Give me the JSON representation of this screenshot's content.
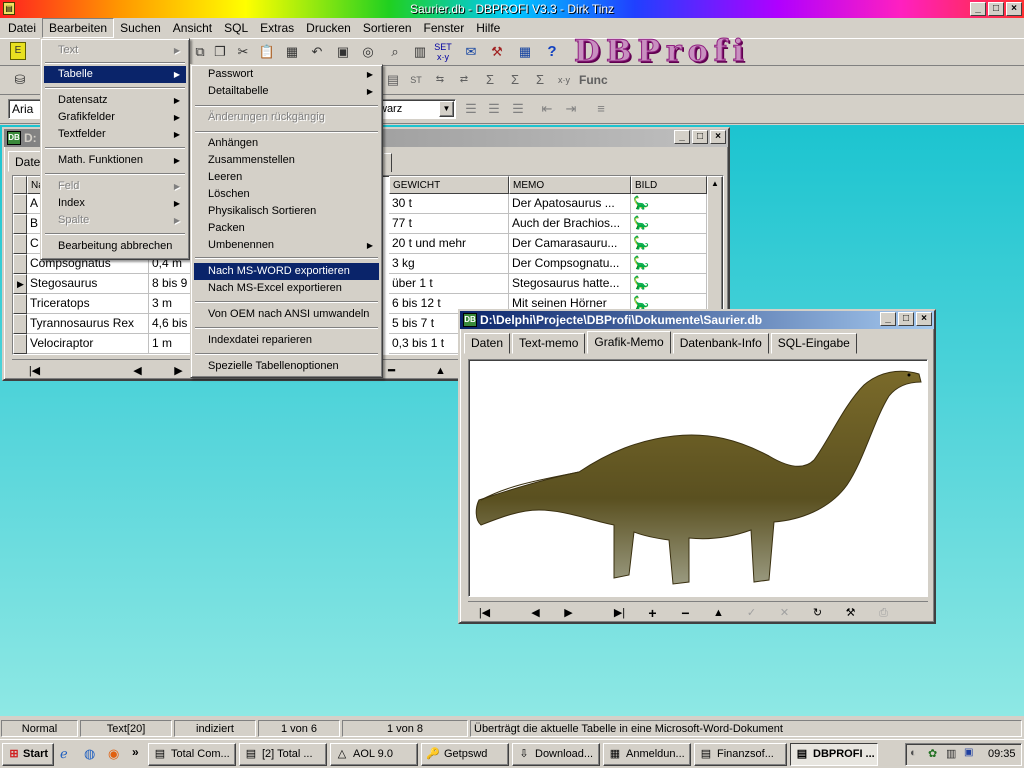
{
  "app": {
    "title": "Saurier.db - DBPROFI V3.3 - Dirk Tinz",
    "logo": "DBProfi",
    "window_buttons": [
      "_",
      "□",
      "×"
    ]
  },
  "menubar": [
    "Datei",
    "Bearbeiten",
    "Suchen",
    "Ansicht",
    "SQL",
    "Extras",
    "Drucken",
    "Sortieren",
    "Fenster",
    "Hilfe"
  ],
  "format_toolbar": {
    "font_value": "Aria",
    "color_value": "warz",
    "func_label": "Func"
  },
  "edit_menu": {
    "items": [
      {
        "label": "Text",
        "disabled": true,
        "submenu": true
      },
      {
        "label": "Tabelle",
        "disabled": false,
        "submenu": true,
        "highlighted": true
      },
      {
        "label": "Datensatz",
        "disabled": false,
        "submenu": true
      },
      {
        "label": "Grafikfelder",
        "disabled": false,
        "submenu": true
      },
      {
        "label": "Textfelder",
        "disabled": false,
        "submenu": true
      },
      {
        "label": "Math. Funktionen",
        "disabled": false,
        "submenu": true
      },
      {
        "label": "Feld",
        "disabled": true,
        "submenu": true
      },
      {
        "label": "Index",
        "disabled": false,
        "submenu": true
      },
      {
        "label": "Spalte",
        "disabled": true,
        "submenu": true
      },
      {
        "label": "Bearbeitung abbrechen",
        "disabled": false,
        "submenu": false
      }
    ]
  },
  "table_submenu": {
    "items": [
      {
        "label": "Passwort",
        "submenu": true
      },
      {
        "label": "Detailtabelle",
        "submenu": true
      },
      {
        "label": "Änderungen rückgängig",
        "disabled": true
      },
      {
        "label": "Anhängen"
      },
      {
        "label": "Zusammenstellen"
      },
      {
        "label": "Leeren"
      },
      {
        "label": "Löschen"
      },
      {
        "label": "Physikalisch Sortieren"
      },
      {
        "label": "Packen"
      },
      {
        "label": "Umbenennen",
        "submenu": true
      },
      {
        "label": "Nach MS-WORD exportieren",
        "highlighted": true
      },
      {
        "label": "Nach MS-Excel exportieren"
      },
      {
        "label": "Von OEM nach ANSI umwandeln"
      },
      {
        "label": "Indexdatei reparieren"
      },
      {
        "label": "Spezielle Tabellenoptionen"
      }
    ]
  },
  "grid_window": {
    "title": "D:",
    "tab_visible": "Date",
    "headers": [
      "Na",
      "",
      "GEWICHT",
      "MEMO",
      "BILD"
    ],
    "rows": [
      {
        "name": "A",
        "length": "",
        "weight": "30 t",
        "memo": "Der Apatosaurus ..."
      },
      {
        "name": "B",
        "length": "",
        "weight": "77 t",
        "memo": "Auch der Brachios..."
      },
      {
        "name": "C",
        "length": "",
        "weight": "20 t und mehr",
        "memo": "Der Camarasauru..."
      },
      {
        "name": "Compsognatus",
        "length": "0,4 m",
        "weight": "3 kg",
        "memo": "Der Compsognatu..."
      },
      {
        "name": "Stegosaurus",
        "length": "8 bis 9",
        "weight": "über 1 t",
        "memo": "Stegosaurus hatte..."
      },
      {
        "name": "Triceratops",
        "length": "3 m",
        "weight": "6 bis 12 t",
        "memo": "Mit seinen Hörner"
      },
      {
        "name": "Tyrannosaurus Rex",
        "length": "4,6 bis",
        "weight": "5 bis 7 t",
        "memo": ""
      },
      {
        "name": "Velociraptor",
        "length": "1 m",
        "weight": "0,3 bis 1 t",
        "memo": ""
      }
    ]
  },
  "image_window": {
    "title": "D:\\Delphi\\Projecte\\DBProfi\\Dokumente\\Saurier.db",
    "tabs": [
      "Daten",
      "Text-memo",
      "Grafik-Memo",
      "Datenbank-Info",
      "SQL-Eingabe"
    ],
    "selected_tab": "Grafik-Memo"
  },
  "statusbar": {
    "panels": [
      "Normal",
      "Text[20]",
      "indiziert",
      "1 von 6",
      "1 von 8"
    ],
    "message": "Überträgt die aktuelle Tabelle in eine Microsoft-Word-Dokument"
  },
  "taskbar": {
    "start": "Start",
    "tasks": [
      "Total Com...",
      "[2] Total ...",
      "AOL 9.0",
      "Getpswd",
      "Download...",
      "Anmeldun...",
      "Finanzsof...",
      "DBPROFI ..."
    ],
    "active_task": "DBPROFI ...",
    "clock": "09:35"
  }
}
